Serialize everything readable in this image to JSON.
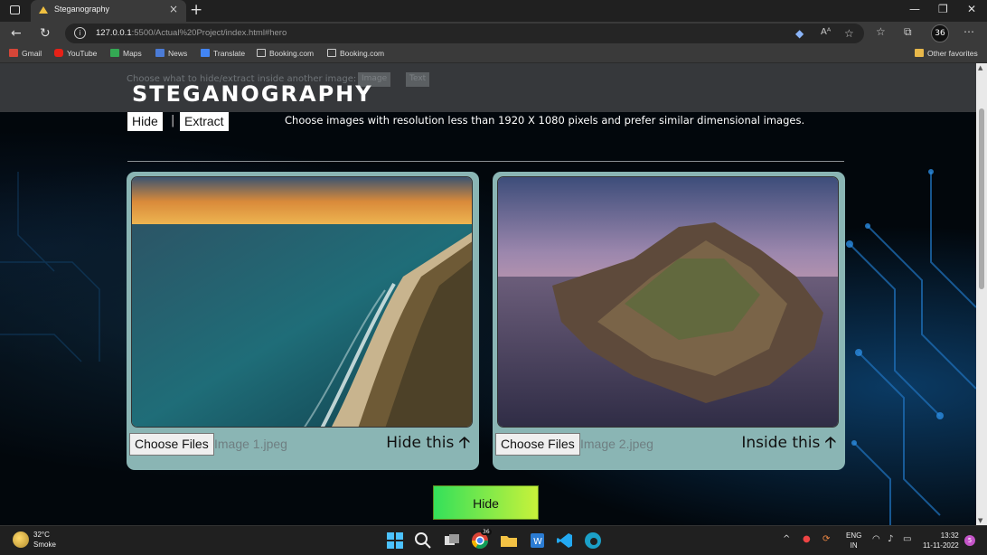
{
  "browser": {
    "tab_title": "Steganography",
    "url_host": "127.0.0.1",
    "url_path": ":5500/Actual%20Project/index.html#hero",
    "profile_badge": "36",
    "bookmarks": [
      "Gmail",
      "YouTube",
      "Maps",
      "News",
      "Translate",
      "Booking.com",
      "Booking.com"
    ],
    "other_favorites": "Other favorites"
  },
  "header": {
    "hint": "Choose what to hide/extract inside another image:",
    "ghost_image": "Image",
    "ghost_text": "Text",
    "logo": "STEGANOGRAPHY"
  },
  "modes": {
    "hide": "Hide",
    "extract": "Extract",
    "separator": "|"
  },
  "note": "Choose images with resolution less than 1920 X 1080 pixels and prefer similar dimensional images.",
  "cards": [
    {
      "choose_label": "Choose Files",
      "file_name": "Image 1.jpeg",
      "label": "Hide this",
      "arrow": "🡡"
    },
    {
      "choose_label": "Choose Files",
      "file_name": "Image 2.jpeg",
      "label": "Inside this",
      "arrow": "🡡"
    }
  ],
  "action_button": "Hide",
  "taskbar": {
    "temperature": "32°C",
    "weather": "Smoke",
    "chrome_badge": "36",
    "lang": "ENG",
    "region": "IN",
    "time": "13:32",
    "date": "11-11-2022",
    "notif_count": "5"
  },
  "colors": {
    "card_bg": "#8ab5b4",
    "header_bg": "#3a3c40",
    "button_gradient_start": "#34e05a",
    "button_gradient_end": "#c8f23a"
  }
}
